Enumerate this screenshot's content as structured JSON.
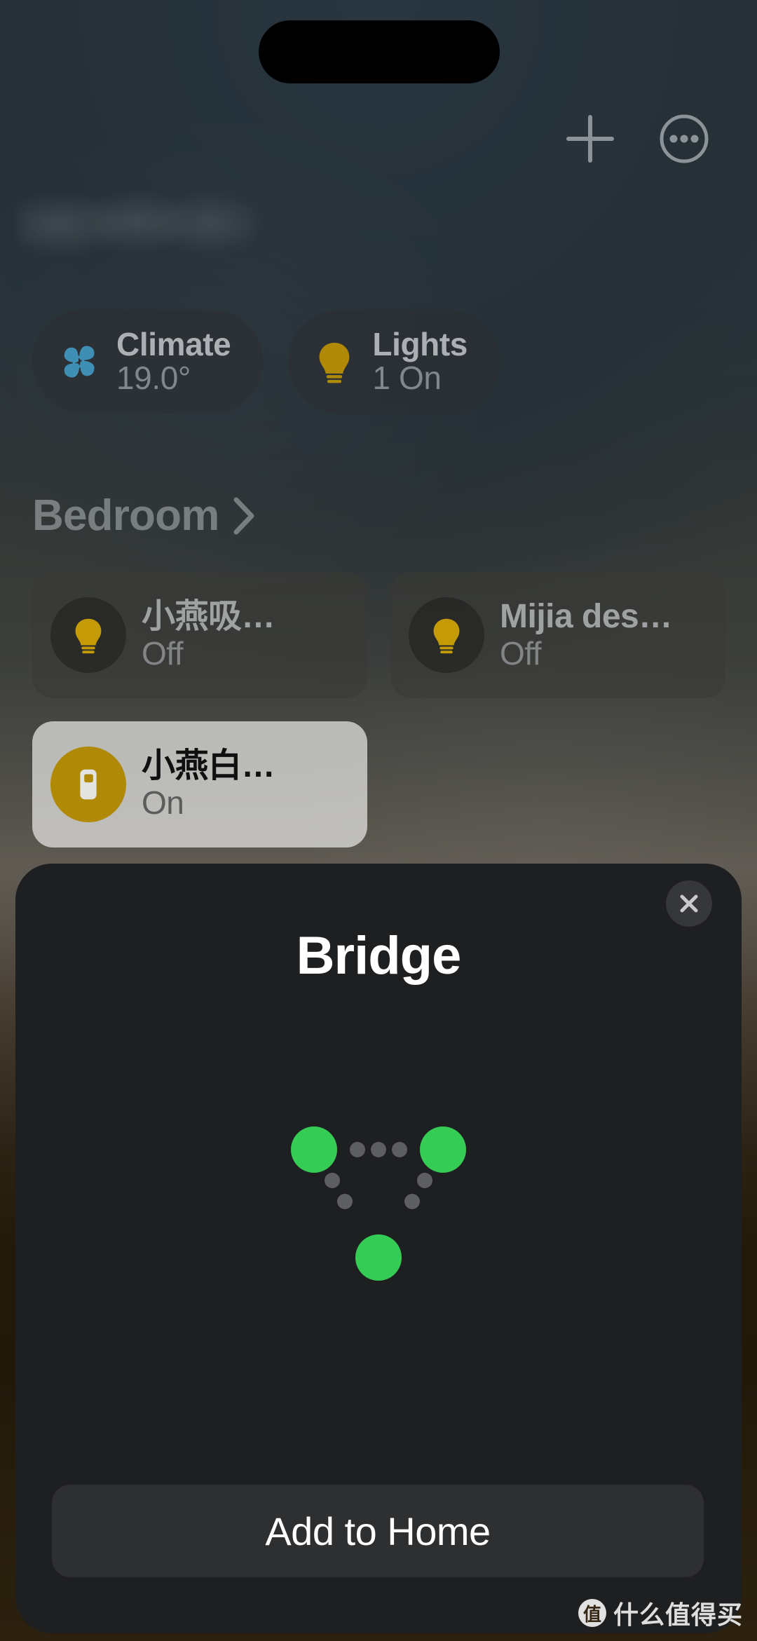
{
  "device": {
    "dynamic_island": "dynamic-island"
  },
  "top_bar": {
    "add_icon": "plus-icon",
    "more_icon": "ellipsis-circle-icon"
  },
  "home": {
    "title_redacted": "",
    "status_pills": [
      {
        "icon": "fan-icon",
        "title": "Climate",
        "value": "19.0°",
        "accent": "#3f8fb5"
      },
      {
        "icon": "bulb-icon",
        "title": "Lights",
        "value": "1 On",
        "accent": "#b08a06"
      }
    ],
    "room": {
      "name": "Bedroom",
      "chevron_icon": "chevron-right-icon"
    },
    "accessories": [
      {
        "icon": "bulb-icon",
        "name": "小燕吸…",
        "state": "Off",
        "on": false
      },
      {
        "icon": "bulb-icon",
        "name": "Mijia des…",
        "state": "Off",
        "on": false
      },
      {
        "icon": "switch-icon",
        "name": "小燕白…",
        "state": "On",
        "on": true
      }
    ]
  },
  "sheet": {
    "title": "Bridge",
    "close_icon": "close-x-icon",
    "graphic": {
      "name": "bridge-network-icon",
      "node_color": "#34cc55",
      "link_color": "#5e5f62",
      "node_count": 3,
      "link_dot_count": 7
    },
    "primary_button": "Add to Home"
  },
  "watermark": {
    "logo_glyph": "值",
    "text": "什么值得买"
  }
}
